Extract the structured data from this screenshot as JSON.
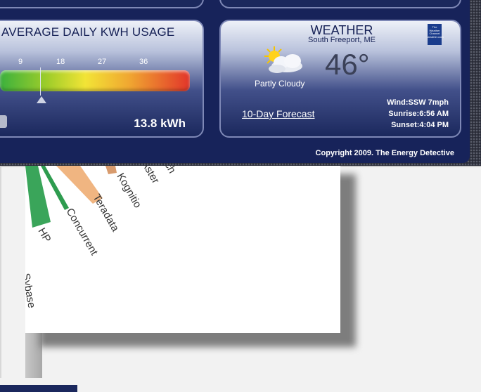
{
  "usage": {
    "title": "AVERAGE DAILY KWH USAGE",
    "ticks": [
      "9",
      "18",
      "27",
      "36"
    ],
    "value": "13.8 kWh"
  },
  "weather": {
    "title": "WEATHER",
    "location": "South Freeport, ME",
    "temperature": "46°",
    "condition": "Partly Cloudy",
    "forecast_link": "10-Day Forecast",
    "wind_label": "Wind:",
    "wind": "SSW 7mph",
    "sunrise_label": "Sunrise:",
    "sunrise": "6:56 AM",
    "sunset_label": "Sunset:",
    "sunset": "4:04 PM",
    "logo_text": "The Weather Channel weather.com"
  },
  "footer": {
    "copyright": "Copyright 2009. The Energy Detective"
  },
  "chart_labels": [
    "HP",
    "Concurrent",
    "Teradata",
    "Kognitio",
    "Aster",
    "ch",
    "Sybase"
  ],
  "colors": {
    "navy": "#17235a",
    "accent_green": "#2e9c4f",
    "teradata_orange": "#f0b581"
  }
}
